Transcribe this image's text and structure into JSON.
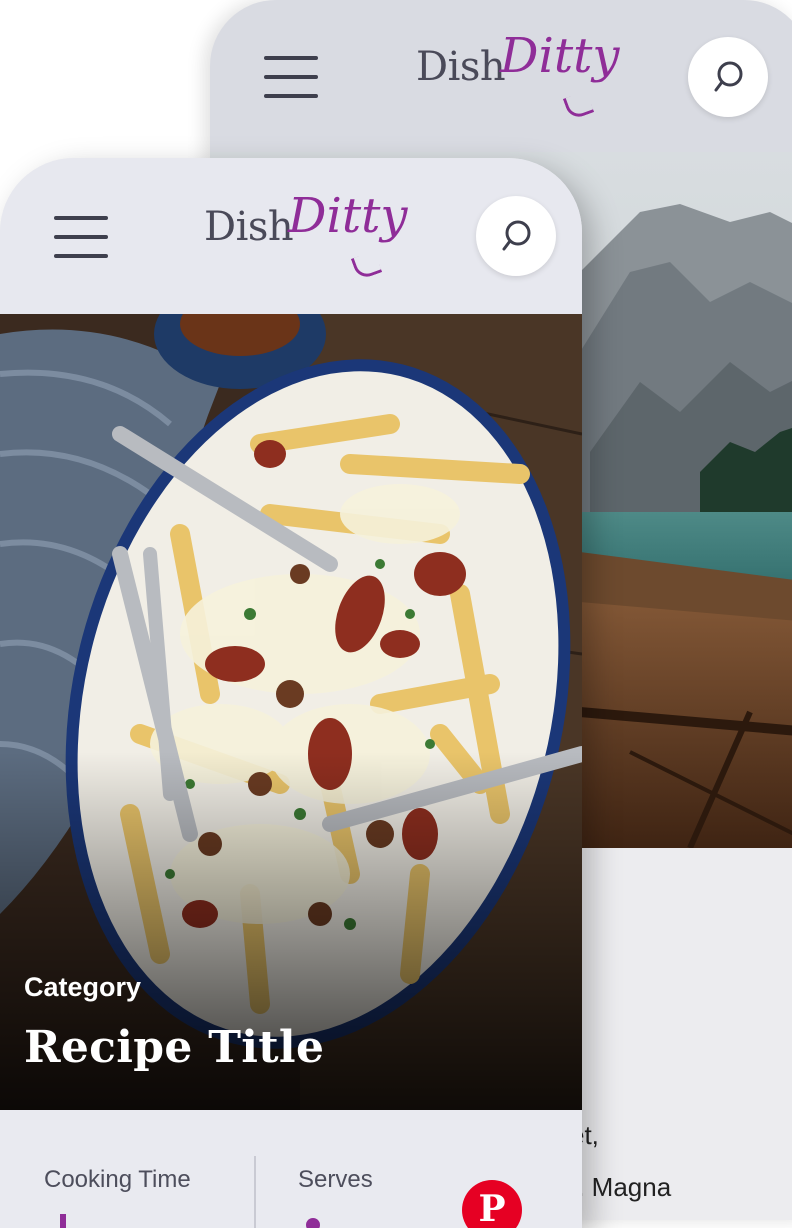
{
  "back_screen": {
    "logo": {
      "part1": "Dish",
      "part2": "Ditty"
    },
    "text_line1": "et,",
    "text_line2": "t. Magna"
  },
  "front_screen": {
    "logo": {
      "part1": "Dish",
      "part2": "Ditty"
    },
    "hero": {
      "category": "Category",
      "title": "Recipe Title"
    },
    "info": {
      "cooking_time_label": "Cooking Time",
      "serves_label": "Serves",
      "pinterest_glyph": "P"
    }
  },
  "colors": {
    "accent": "#8f2d98",
    "header_front": "#e7e8ef",
    "header_back": "#d9dbe2",
    "text_dark": "#3e3f4d",
    "pinterest": "#e60023"
  },
  "icons": [
    "hamburger-menu-icon",
    "search-icon",
    "pinterest-icon"
  ]
}
